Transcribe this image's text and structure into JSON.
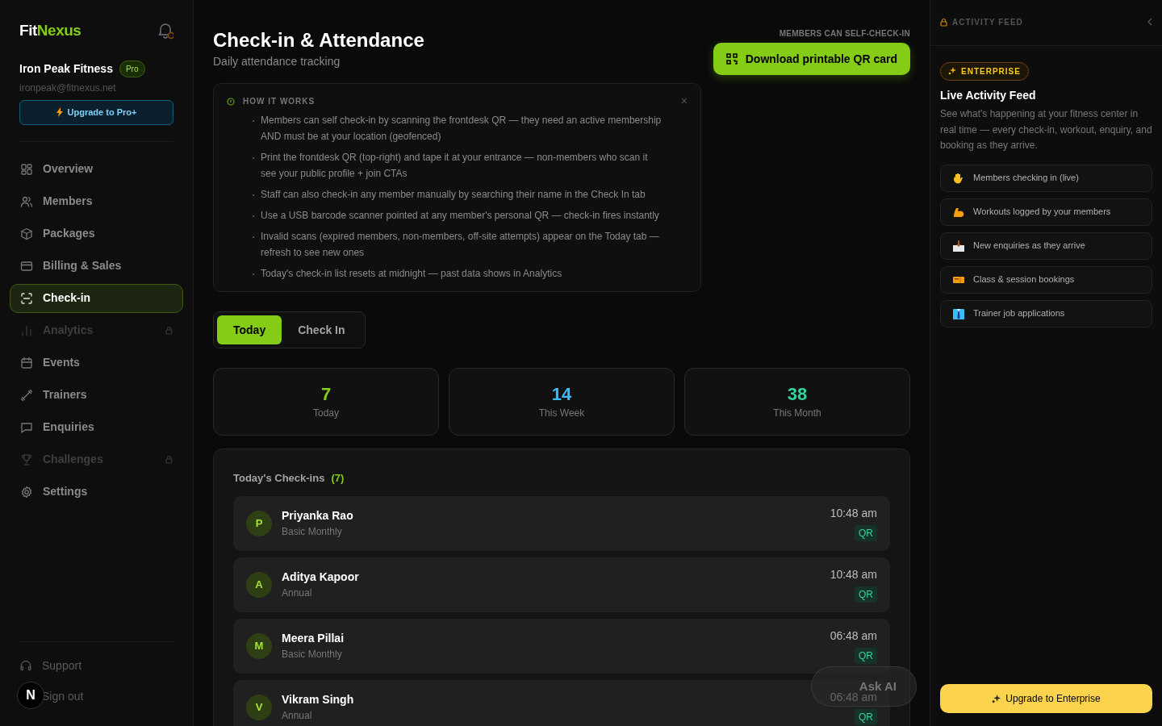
{
  "brand": {
    "part_1": "Fit",
    "part_2": "Nexus"
  },
  "gym": {
    "name": "Iron Peak Fitness",
    "plan": "Pro",
    "email": "ironpeak@fitnexus.net",
    "upgrade": "Upgrade to Pro+"
  },
  "nav": [
    {
      "kind": "grid",
      "label": "Overview",
      "selected": false,
      "locked": false
    },
    {
      "kind": "users",
      "label": "Members",
      "selected": false,
      "locked": false
    },
    {
      "kind": "box",
      "label": "Packages",
      "selected": false,
      "locked": false
    },
    {
      "kind": "card",
      "label": "Billing & Sales",
      "selected": false,
      "locked": false
    },
    {
      "kind": "scan",
      "label": "Check-in",
      "selected": true,
      "locked": false
    },
    {
      "kind": "chart",
      "label": "Analytics",
      "selected": false,
      "locked": true
    },
    {
      "kind": "calendar",
      "label": "Events",
      "selected": false,
      "locked": false
    },
    {
      "kind": "dumbbell",
      "label": "Trainers",
      "selected": false,
      "locked": false
    },
    {
      "kind": "message",
      "label": "Enquiries",
      "selected": false,
      "locked": false
    },
    {
      "kind": "trophy",
      "label": "Challenges",
      "selected": false,
      "locked": true
    },
    {
      "kind": "gear",
      "label": "Settings",
      "selected": false,
      "locked": false
    }
  ],
  "footer_nav": [
    {
      "kind": "headset",
      "label": "Support"
    },
    {
      "label": "Sign out"
    }
  ],
  "dev_badge": "N",
  "header": {
    "title": "Check-in & Attendance",
    "subtitle": "Daily attendance tracking",
    "note": "MEMBERS CAN SELF-CHECK-IN",
    "action": "Download printable QR card"
  },
  "how_it_works": {
    "title": "HOW IT WORKS",
    "close": "×",
    "items": [
      "Members can self check-in by scanning the frontdesk QR — they need an active membership AND must be at your location (geofenced)",
      "Print the frontdesk QR (top-right) and tape it at your entrance — non-members who scan it see your public profile + join CTAs",
      "Staff can also check-in any member manually by searching their name in the Check In tab",
      "Use a USB barcode scanner pointed at any member's personal QR — check-in fires instantly",
      "Invalid scans (expired members, non-members, off-site attempts) appear on the Today tab — refresh to see new ones",
      "Today's check-in list resets at midnight — past data shows in Analytics"
    ]
  },
  "tabs": [
    {
      "label": "Today",
      "selected": true
    },
    {
      "label": "Check In",
      "selected": false
    }
  ],
  "stats": [
    {
      "value": "7",
      "label": "Today",
      "color": "#84cc16"
    },
    {
      "value": "14",
      "label": "This Week",
      "color": "#38bdf8"
    },
    {
      "value": "38",
      "label": "This Month",
      "color": "#34d399"
    }
  ],
  "checkins": {
    "title": "Today's Check-ins",
    "count": "(7)",
    "rows": [
      {
        "initial": "P",
        "name": "Priyanka Rao",
        "plan": "Basic Monthly",
        "time": "10:48 am",
        "method": "QR"
      },
      {
        "initial": "A",
        "name": "Aditya Kapoor",
        "plan": "Annual",
        "time": "10:48 am",
        "method": "QR"
      },
      {
        "initial": "M",
        "name": "Meera Pillai",
        "plan": "Basic Monthly",
        "time": "06:48 am",
        "method": "QR"
      },
      {
        "initial": "V",
        "name": "Vikram Singh",
        "plan": "Annual",
        "time": "06:48 am",
        "method": "QR"
      }
    ]
  },
  "ask_ai": "Ask AI",
  "activity": {
    "header": "ACTIVITY FEED",
    "badge": "ENTERPRISE",
    "title": "Live Activity Feed",
    "description": "See what's happening at your fitness center in real time — every check-in, workout, enquiry, and booking as they arrive.",
    "items": [
      {
        "kind": "hand",
        "label": "Members checking in (live)"
      },
      {
        "kind": "arm",
        "label": "Workouts logged by your members"
      },
      {
        "kind": "inbox",
        "label": "New enquiries as they arrive"
      },
      {
        "kind": "ticket",
        "label": "Class & session bookings"
      },
      {
        "kind": "tie",
        "label": "Trainer job applications"
      }
    ],
    "upgrade": "Upgrade to Enterprise"
  }
}
